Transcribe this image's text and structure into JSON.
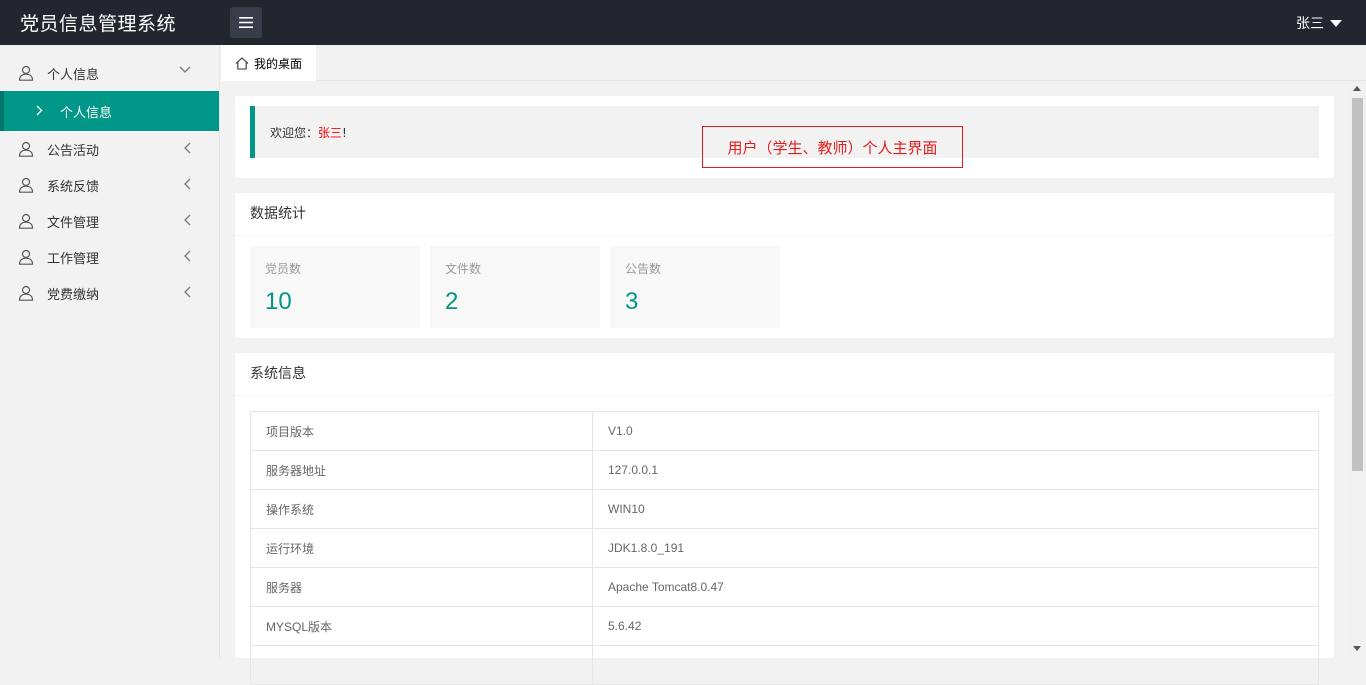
{
  "app": {
    "title": "党员信息管理系统",
    "user_name": "张三"
  },
  "sidebar": {
    "items": [
      {
        "label": "个人信息",
        "expanded": true,
        "children": [
          {
            "label": "个人信息",
            "active": true
          }
        ]
      },
      {
        "label": "公告活动",
        "expanded": false
      },
      {
        "label": "系统反馈",
        "expanded": false
      },
      {
        "label": "文件管理",
        "expanded": false
      },
      {
        "label": "工作管理",
        "expanded": false
      },
      {
        "label": "党费缴纳",
        "expanded": false
      }
    ]
  },
  "tabs": [
    {
      "label": "我的桌面",
      "icon": "home-icon"
    }
  ],
  "welcome": {
    "prefix": "欢迎您：",
    "name": "张三",
    "suffix": "!",
    "annotation": "用户（学生、教师）个人主界面"
  },
  "stats": {
    "title": "数据统计",
    "items": [
      {
        "label": "党员数",
        "value": "10"
      },
      {
        "label": "文件数",
        "value": "2"
      },
      {
        "label": "公告数",
        "value": "3"
      }
    ]
  },
  "system_info": {
    "title": "系统信息",
    "rows": [
      {
        "key": "项目版本",
        "value": "V1.0"
      },
      {
        "key": "服务器地址",
        "value": "127.0.0.1"
      },
      {
        "key": "操作系统",
        "value": "WIN10"
      },
      {
        "key": "运行环境",
        "value": "JDK1.8.0_191"
      },
      {
        "key": "服务器",
        "value": "Apache Tomcat8.0.47"
      },
      {
        "key": "MYSQL版本",
        "value": "5.6.42"
      },
      {
        "key": "",
        "value": ""
      }
    ]
  },
  "colors": {
    "header_bg": "#23262e",
    "accent": "#009688",
    "highlight_red": "#e01e1e"
  }
}
